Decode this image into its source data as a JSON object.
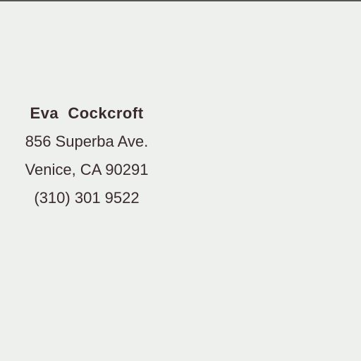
{
  "card": {
    "name": "Eva  Cockcroft",
    "street": "856 Superba Ave.",
    "city": "Venice, CA 90291",
    "phone": "(310) 301 9522"
  },
  "colors": {
    "paper": "#eef0ee",
    "ink": "#3a2b2c"
  }
}
